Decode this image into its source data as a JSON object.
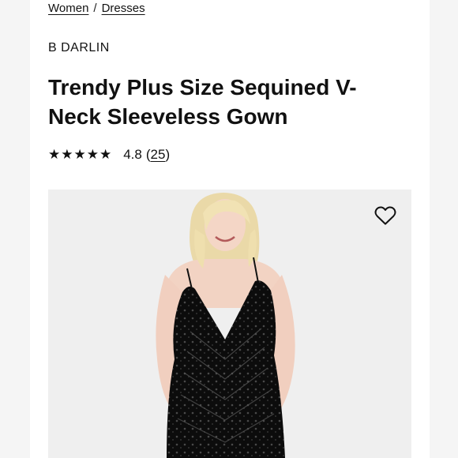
{
  "breadcrumb": {
    "items": [
      "Women",
      "Dresses"
    ],
    "separator": "/"
  },
  "product": {
    "brand": "B DARLIN",
    "title": "Trendy Plus Size Sequined V-Neck Sleeveless Gown",
    "rating": {
      "stars": "★★★★★",
      "value": "4.8",
      "review_count": "25",
      "open_paren": "(",
      "close_paren": ")"
    }
  },
  "image": {
    "wishlist_icon": "heart-outline-icon",
    "background": "#efefef",
    "dress_color": "#0c0c0c"
  }
}
